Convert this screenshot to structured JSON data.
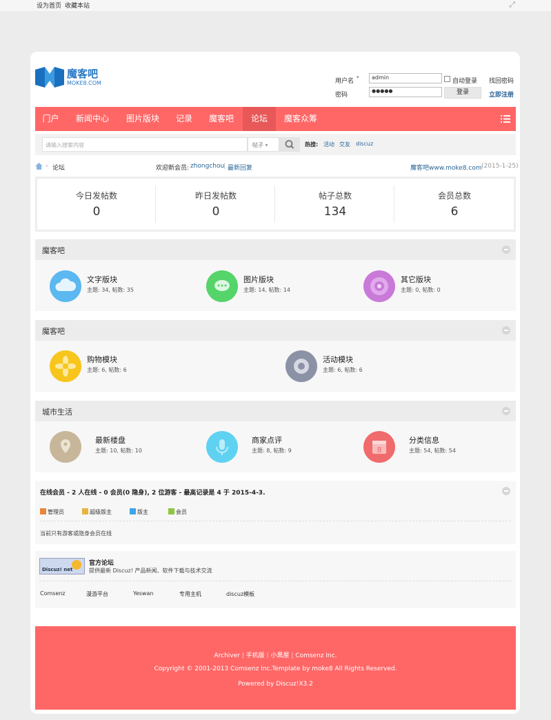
{
  "topbar": {
    "set_home": "设为首页",
    "bookmark": "收藏本站"
  },
  "logo": {
    "title": "魔客吧",
    "subtitle": "MOKE8.COM"
  },
  "login": {
    "username_label": "用户名",
    "username_value": "admin",
    "auto_login_label": "自动登录",
    "forgot_password": "找回密码",
    "password_label": "密码",
    "password_value": "●●●●●",
    "login_button": "登录",
    "register": "立即注册"
  },
  "nav": {
    "items": [
      "门户",
      "新闻中心",
      "图片版块",
      "记录",
      "魔客吧",
      "论坛",
      "魔客众筹"
    ],
    "active_index": 5
  },
  "search": {
    "placeholder": "请输入搜索内容",
    "select_value": "帖子",
    "hot_label": "热搜:",
    "hot_items": [
      "活动",
      "交友",
      "discuz"
    ]
  },
  "breadcrumb": {
    "current": "论坛",
    "welcome_label": "欢迎新会员:",
    "new_member": "zhongchou",
    "sep": "|",
    "latest": "最新回复",
    "site_link": "魔客吧www.moke8.com",
    "date": "(2015-1-25)"
  },
  "stats": [
    {
      "label": "今日发帖数",
      "value": "0"
    },
    {
      "label": "昨日发帖数",
      "value": "0"
    },
    {
      "label": "帖子总数",
      "value": "134"
    },
    {
      "label": "会员总数",
      "value": "6"
    }
  ],
  "sections": [
    {
      "title": "魔客吧",
      "forums": [
        {
          "name": "文字版块",
          "meta": "主题: 34, 帖数: 35",
          "icon": "cloud-icon",
          "color": "#5bb8f0"
        },
        {
          "name": "图片版块",
          "meta": "主题: 14, 帖数: 14",
          "icon": "chat-bubble-icon",
          "color": "#55d46a"
        },
        {
          "name": "其它版块",
          "meta": "主题: 0, 帖数: 0",
          "icon": "ring-icon",
          "color": "#c97ad8"
        }
      ]
    },
    {
      "title": "魔客吧",
      "forums": [
        {
          "name": "购物模块",
          "meta": "主题: 6, 帖数: 6",
          "icon": "flower-icon",
          "color": "#f7c51c"
        },
        {
          "name": "活动模块",
          "meta": "主题: 6, 帖数: 6",
          "icon": "gear-icon",
          "color": "#8c92a6"
        }
      ]
    },
    {
      "title": "城市生活",
      "forums": [
        {
          "name": "最新楼盘",
          "meta": "主题: 10, 帖数: 10",
          "icon": "location-pin-icon",
          "color": "#c7b69a"
        },
        {
          "name": "商家点评",
          "meta": "主题: 8, 帖数: 9",
          "icon": "microphone-icon",
          "color": "#5fd2f2"
        },
        {
          "name": "分类信息",
          "meta": "主题: 54, 帖数: 54",
          "icon": "calendar-icon",
          "color": "#f06b6b"
        }
      ]
    }
  ],
  "online": {
    "title": "在线会员 - 2 人在线 - 0 会员(0 隐身), 2 位游客 - 最高记录是 4 于 2015-4-3.",
    "legend": [
      {
        "label": "管理员",
        "color": "#e8863a"
      },
      {
        "label": "超级版主",
        "color": "#e8b43a"
      },
      {
        "label": "版主",
        "color": "#3aa7e8"
      },
      {
        "label": "会员",
        "color": "#8cc63f"
      }
    ],
    "note": "当前只有游客或隐身会员在线"
  },
  "friend_links": {
    "badge_text": "Discuz! net",
    "name": "官方论坛",
    "desc": "提供最新 Discuz! 产品新闻、软件下载与技术交流",
    "links": [
      "Comsenz",
      "漫游平台",
      "Yeswan",
      "专用主机",
      "discuz模板"
    ]
  },
  "footer": {
    "links": [
      "Archiver",
      "手机版",
      "小黑屋",
      "Comsenz Inc."
    ],
    "copyright": "Copyright © 2001-2013 Comsenz Inc.Template by moke8 All Rights Reserved.",
    "powered": "Powered by Discuz!X3.2"
  }
}
